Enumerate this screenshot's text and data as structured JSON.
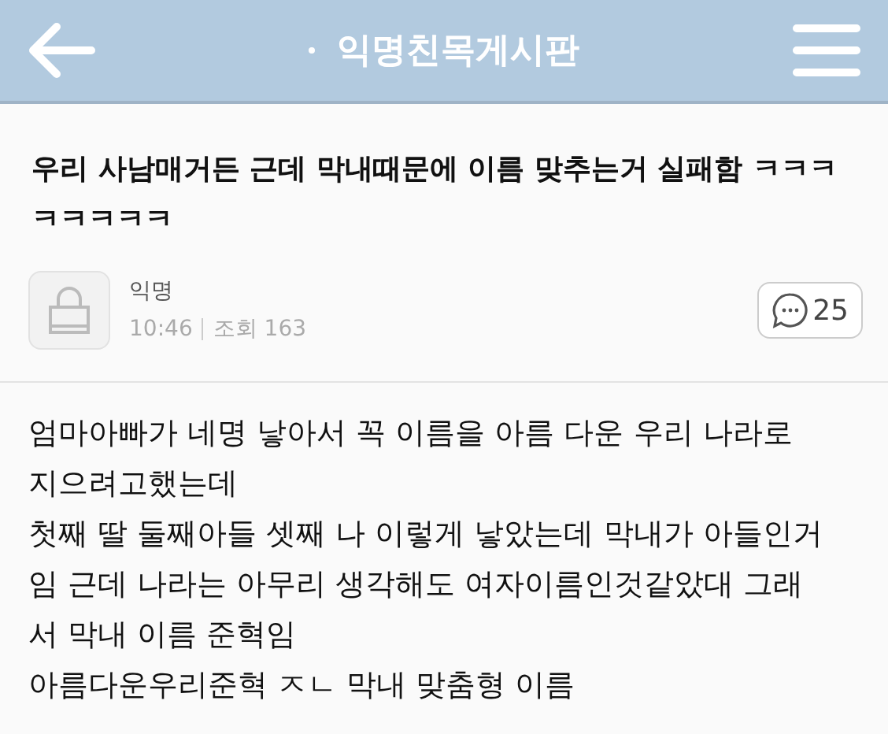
{
  "header": {
    "title": "익명친목게시판"
  },
  "post": {
    "title": "우리 사남매거든 근데 막내때문에 이름 맞추는거 실패함 ㅋㅋㅋㅋㅋㅋㅋㅋ",
    "author": "익명",
    "time": "10:46",
    "views": "조회 163",
    "comments": "25",
    "body": [
      "엄마아빠가 네명 낳아서 꼭 이름을 아름 다운 우리 나라로",
      "지으려고했는데",
      "첫째 딸 둘째아들 셋째 나 이렇게 낳았는데 막내가 아들인거",
      "임 근데 나라는 아무리 생각해도 여자이름인것같았대 그래",
      "서 막내 이름 준혁임",
      "아름다운우리준혁 ㅈㄴ 막내 맞춤형 이름"
    ]
  }
}
